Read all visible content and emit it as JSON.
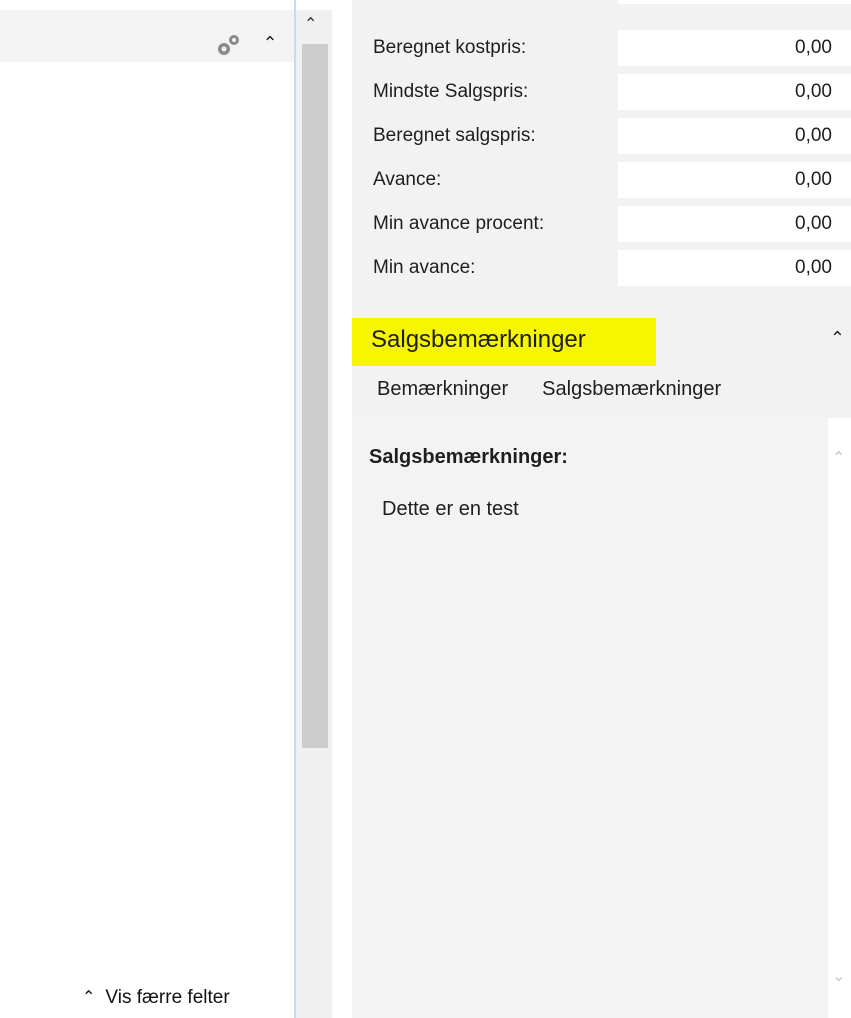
{
  "left_panel": {
    "gear_icon": "gears-icon",
    "collapse_icon": "chevron-up-icon",
    "footer_link": "Vis færre felter"
  },
  "fields": [
    {
      "label": "Beregnet kostpris:",
      "value": "0,00"
    },
    {
      "label": "Mindste Salgspris:",
      "value": "0,00"
    },
    {
      "label": "Beregnet salgspris:",
      "value": "0,00"
    },
    {
      "label": "Avance:",
      "value": "0,00"
    },
    {
      "label": "Min avance procent:",
      "value": "0,00"
    },
    {
      "label": "Min avance:",
      "value": "0,00"
    }
  ],
  "section": {
    "title": "Salgsbemærkninger",
    "highlight_color": "#f6f600",
    "tabs": [
      "Bemærkninger",
      "Salgsbemærkninger"
    ]
  },
  "content": {
    "heading": "Salgsbemærkninger:",
    "text": "Dette er en test"
  }
}
